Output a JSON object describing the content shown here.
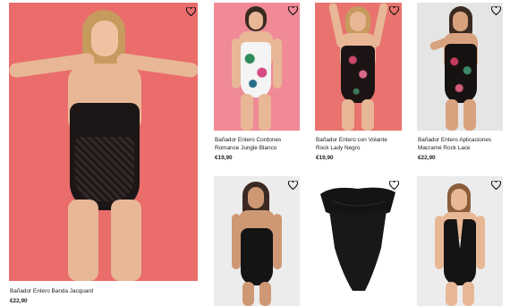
{
  "products": [
    {
      "name": "Bañador Entero Banda Jacquard",
      "price": "€22,90",
      "image_alt": "Black strapless lace swimsuit on red background",
      "wishlist_icon": "heart-outline-icon",
      "bg": "#ea6d6b"
    },
    {
      "name_line1": "Bañador Entero Cordones",
      "name_line2": "Romance Jungle Blanco",
      "price": "€19,90",
      "image_alt": "White tropical print swimsuit on pink background",
      "wishlist_icon": "heart-outline-icon",
      "bg": "#f08a96"
    },
    {
      "name_line1": "Bañador Entero con Volante",
      "name_line2": "Rock Lady Negro",
      "price": "€19,90",
      "image_alt": "Black floral ruffle swimsuit on coral background",
      "wishlist_icon": "heart-outline-icon",
      "bg": "#e9736e"
    },
    {
      "name_line1": "Bañador Entero Aplicaciones",
      "name_line2": "Macramé Rock Lace",
      "price": "€22,90",
      "image_alt": "Black floral macrame swimsuit on grey background",
      "wishlist_icon": "heart-outline-icon",
      "bg": "#e5e5e5"
    },
    {
      "image_alt": "Black bandeau swimsuit on grey background",
      "wishlist_icon": "heart-outline-icon",
      "bg": "#ececec"
    },
    {
      "image_alt": "Black ruffle bandeau swimsuit product shot",
      "wishlist_icon": "heart-outline-icon",
      "bg": "#ffffff"
    },
    {
      "image_alt": "Black plunge swimsuit with buttons on grey background",
      "wishlist_icon": "heart-outline-icon",
      "bg": "#ececec"
    }
  ]
}
